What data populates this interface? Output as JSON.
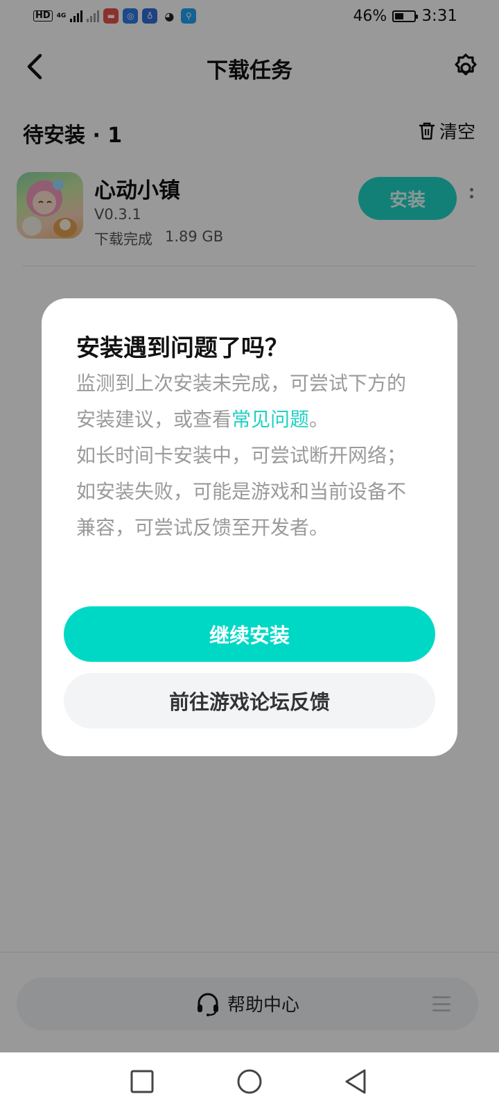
{
  "status_bar": {
    "hd": "HD",
    "net": "4G",
    "battery_percent_text": "46%",
    "battery_level": 0.46,
    "time": "3:31"
  },
  "nav": {
    "title": "下载任务",
    "back_icon": "back-chevron-icon",
    "settings_icon": "gear-icon"
  },
  "section": {
    "title": "待安装 · 1",
    "clear_label": "清空",
    "clear_icon": "trash-icon"
  },
  "app": {
    "name": "心动小镇",
    "version": "V0.3.1",
    "status": "下载完成",
    "size": "1.89 GB",
    "install_label": "安装"
  },
  "dialog": {
    "title": "安装遇到问题了吗？",
    "line1_before_link": "监测到上次安装未完成，可尝试下方的安装建议，或查看",
    "link_text": "常见问题",
    "line1_after_link": "。",
    "line2": "如长时间卡安装中，可尝试断开网络；",
    "line3": "如安装失败，可能是游戏和当前设备不兼容，可尝试反馈至开发者。",
    "primary_button": "继续安装",
    "secondary_button": "前往游戏论坛反馈"
  },
  "help": {
    "label": "帮助中心",
    "icon": "headset-icon"
  },
  "colors": {
    "accent": "#00D8C6",
    "link": "#1FD1C1",
    "overlay": "rgba(0,0,0,0.40)"
  }
}
